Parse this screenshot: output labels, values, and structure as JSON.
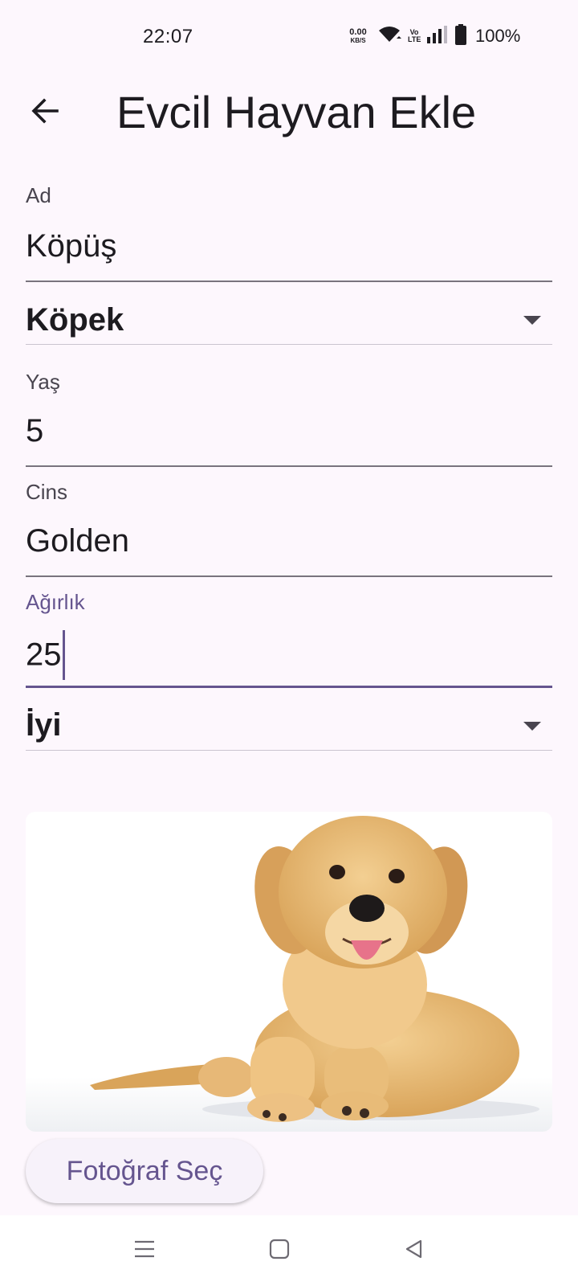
{
  "status_bar": {
    "time": "22:07",
    "net_speed_value": "0.00",
    "net_speed_unit": "KB/S",
    "volte_top": "Vo",
    "volte_bottom": "LTE",
    "battery_percent": "100%",
    "icons": [
      "wifi-icon",
      "signal-icon",
      "battery-icon"
    ]
  },
  "app_bar": {
    "title": "Evcil Hayvan Ekle",
    "back_icon": "arrow-left-icon"
  },
  "form": {
    "name": {
      "label": "Ad",
      "value": "Köpüş"
    },
    "species": {
      "value": "Köpek",
      "icon": "dropdown-arrow-icon"
    },
    "age": {
      "label": "Yaş",
      "value": "5"
    },
    "breed": {
      "label": "Cins",
      "value": "Golden"
    },
    "weight": {
      "label": "Ağırlık",
      "value": "25"
    },
    "health": {
      "value": "İyi",
      "icon": "dropdown-arrow-icon"
    }
  },
  "photo": {
    "subject": "golden-retriever-puppy"
  },
  "actions": {
    "pick_photo_label": "Fotoğraf Seç"
  },
  "colors": {
    "background": "#fdf7fd",
    "accent": "#65558f",
    "text": "#1d1b20",
    "label": "#49454f"
  },
  "nav_bar": {
    "icons": [
      "menu-icon",
      "home-square-icon",
      "back-triangle-icon"
    ]
  }
}
